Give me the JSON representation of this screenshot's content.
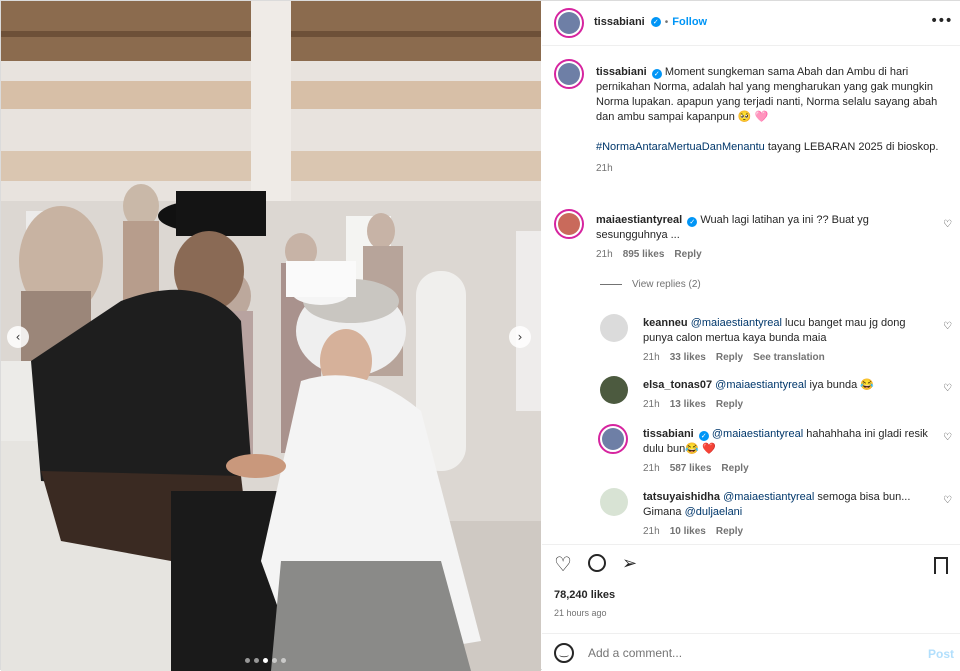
{
  "post": {
    "author": "tissabiani",
    "follow_label": "Follow",
    "separator": "•",
    "more_icon": "more-horizontal-icon",
    "caption_body": "Moment sungkeman sama Abah dan Ambu di hari pernikahan Norma, adalah hal yang mengharukan yang gak mungkin Norma lupakan. apapun yang terjadi nanti, Norma selalu sayang abah dan ambu sampai kapanpun 🥺 🩷",
    "caption_hashtag": "#NormaAntaraMertuaDanMenantu",
    "caption_tail": "tayang LEBARAN 2025 di bioskop.",
    "caption_time": "21h",
    "likes": "78,240 likes",
    "posted": "21 hours ago"
  },
  "comments": [
    {
      "user": "maiaestiantyreal",
      "verified": true,
      "text": "Wuah lagi latihan ya ini ?? Buat yg sesungguhnya ...",
      "time": "21h",
      "likes": "895 likes",
      "reply": "Reply",
      "view_replies": "View replies (2)"
    },
    {
      "user": "keanneu",
      "mention": "@maiaestiantyreal",
      "text": "lucu banget mau jg dong punya calon mertua kaya bunda maia",
      "time": "21h",
      "likes": "33 likes",
      "reply": "Reply",
      "translate": "See translation"
    },
    {
      "user": "elsa_tonas07",
      "mention": "@maiaestiantyreal",
      "text": "iya bunda 😂",
      "time": "21h",
      "likes": "13 likes",
      "reply": "Reply"
    },
    {
      "user": "tissabiani",
      "verified": true,
      "mention": "@maiaestiantyreal",
      "text": "hahahhaha ini gladi resik dulu bun😂 ❤️",
      "time": "21h",
      "likes": "587 likes",
      "reply": "Reply"
    },
    {
      "user": "tatsuyaishidha",
      "mention": "@maiaestiantyreal",
      "text": "semoga bisa bun... Gimana",
      "mention2": "@duljaelani",
      "time": "21h",
      "likes": "10 likes",
      "reply": "Reply"
    }
  ],
  "composer": {
    "placeholder": "Add a comment...",
    "post_label": "Post"
  },
  "carousel": {
    "dot_count": 5,
    "active_index": 2
  },
  "colors": {
    "link": "#00376b",
    "follow": "#0095f6",
    "heart_red": "#ed4956",
    "story_ring": "#d6249f"
  }
}
